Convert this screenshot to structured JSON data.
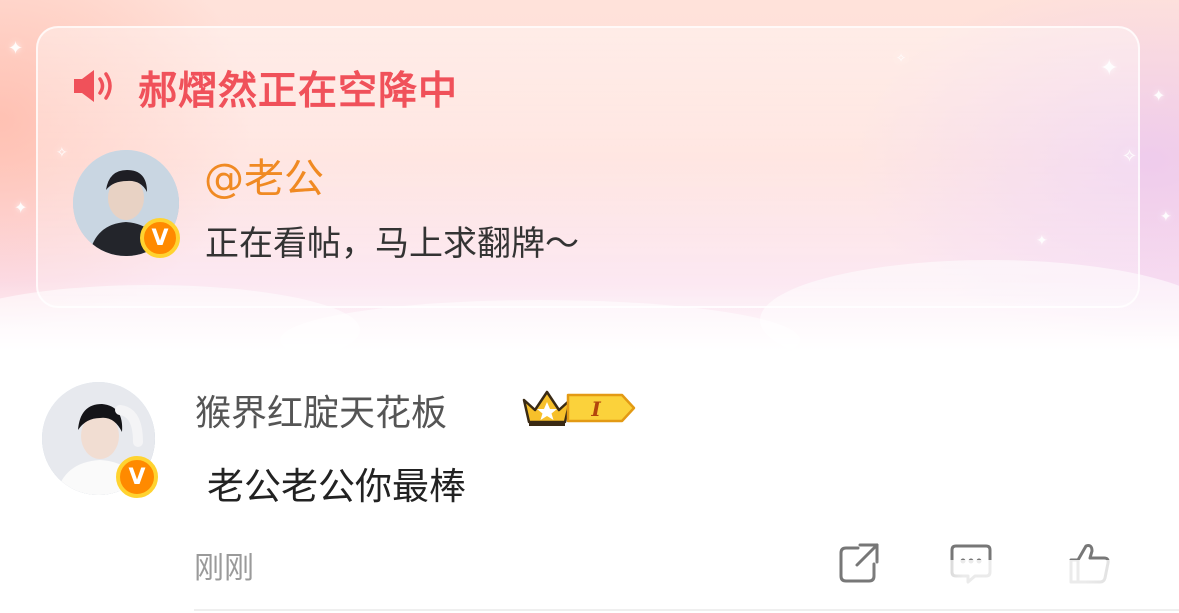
{
  "banner": {
    "announcement": "郝熠然正在空降中",
    "mention": "@老公",
    "note": "正在看帖，马上求翻牌～",
    "verified_badge": "V"
  },
  "comment": {
    "username": "猴界红腚天花板",
    "level_badge": "I",
    "text": "老公老公你最棒",
    "timestamp": "刚刚",
    "verified_badge": "V"
  },
  "icons": {
    "speaker": "speaker-icon",
    "crown": "crown-icon",
    "share": "share-icon",
    "reply": "comment-icon",
    "like": "thumbs-up-icon"
  }
}
